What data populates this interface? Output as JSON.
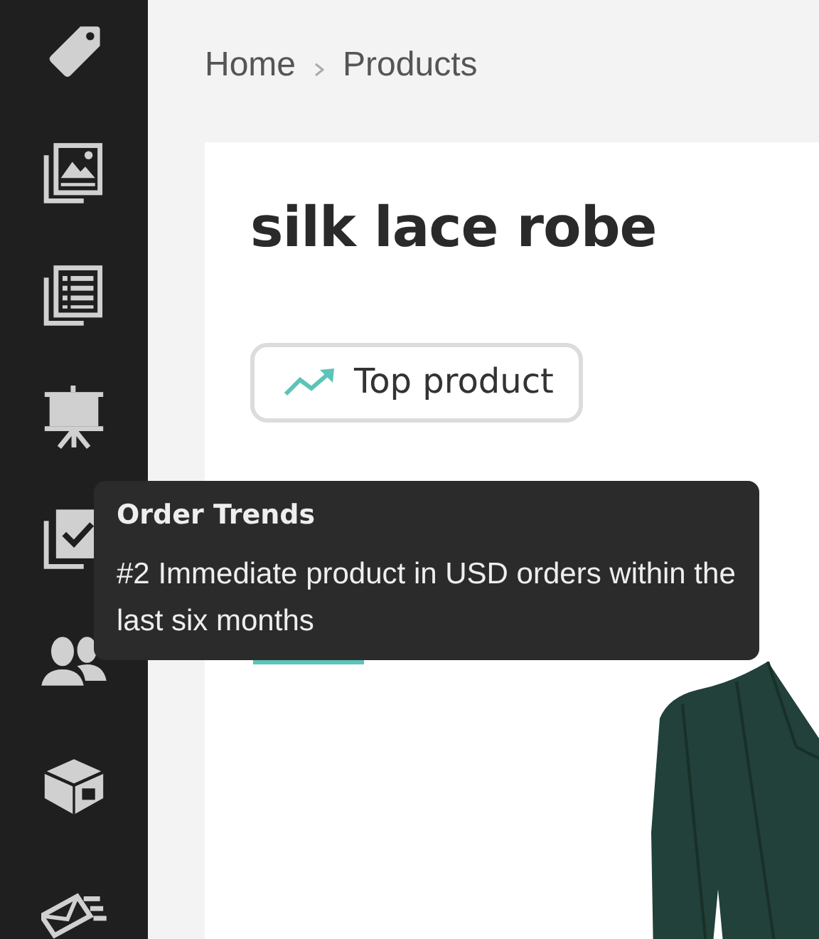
{
  "sidebar": {
    "items": [
      {
        "kind": "tag"
      },
      {
        "kind": "gallery"
      },
      {
        "kind": "list"
      },
      {
        "kind": "presentation"
      },
      {
        "kind": "checklist"
      },
      {
        "kind": "people"
      },
      {
        "kind": "box"
      },
      {
        "kind": "mail"
      }
    ]
  },
  "breadcrumb": [
    "Home",
    "Products"
  ],
  "product": {
    "title": "silk lace robe",
    "badge": "Top product"
  },
  "tooltip": {
    "title": "Order Trends",
    "text": "#2 Immediate product in USD orders within the last six months"
  }
}
